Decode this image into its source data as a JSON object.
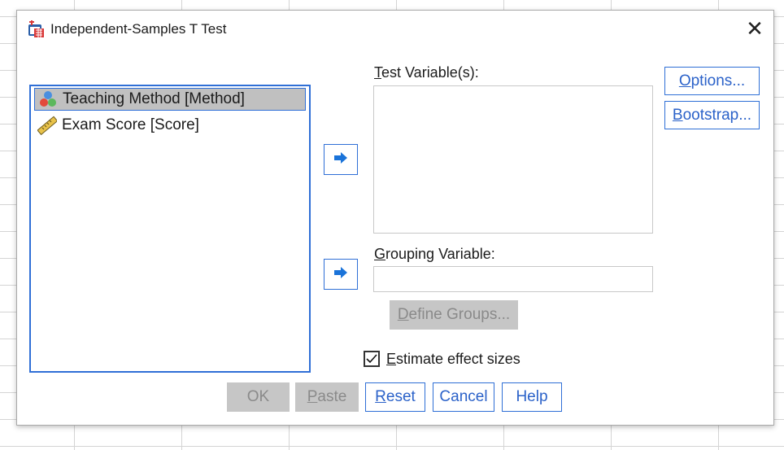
{
  "dialog": {
    "title": "Independent-Samples T Test",
    "close_glyph": "✕",
    "icon": "t-test-dialog-icon"
  },
  "source_list": {
    "items": [
      {
        "label": "Teaching Method [Method]",
        "icon": "nominal-variable-icon",
        "selected": true
      },
      {
        "label": "Exam Score [Score]",
        "icon": "scale-ruler-icon",
        "selected": false
      }
    ]
  },
  "test_variables": {
    "mnemonic": "T",
    "label_rest": "est Variable(s):"
  },
  "grouping_variable": {
    "mnemonic": "G",
    "label_rest": "rouping Variable:",
    "value": ""
  },
  "define_groups": {
    "mnemonic": "D",
    "label_rest": "efine Groups..."
  },
  "side_buttons": {
    "options": {
      "mnemonic": "O",
      "label_rest": "ptions..."
    },
    "bootstrap": {
      "mnemonic": "B",
      "label_rest": "ootstrap..."
    }
  },
  "effect_sizes": {
    "mnemonic": "E",
    "label_rest": "stimate effect sizes",
    "checked": true
  },
  "bottom_buttons": {
    "ok": "OK",
    "paste": {
      "mnemonic": "P",
      "label_rest": "aste"
    },
    "reset": {
      "mnemonic": "R",
      "label_rest": "eset"
    },
    "cancel": "Cancel",
    "help": "Help"
  },
  "colors": {
    "accent": "#2f6fd6",
    "arrow": "#1a73d9",
    "disabled_bg": "#c6c6c6"
  }
}
